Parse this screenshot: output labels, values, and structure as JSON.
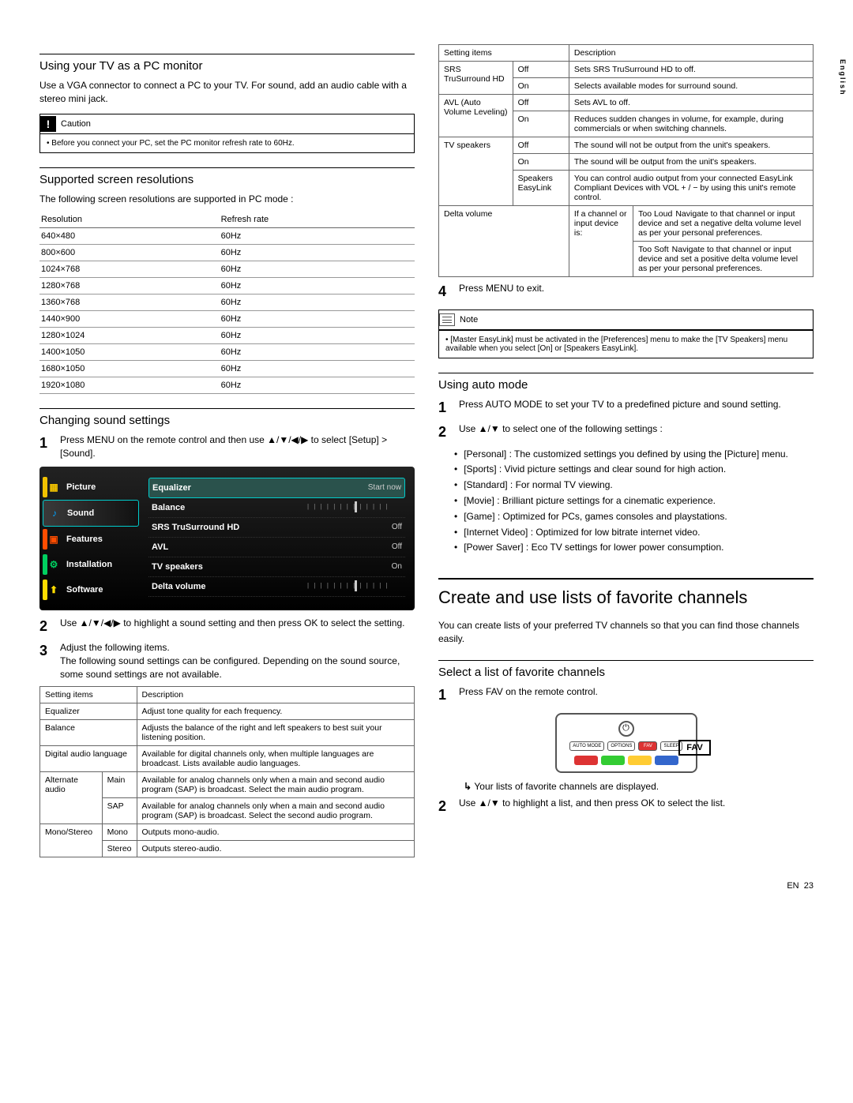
{
  "lang_tab": "English",
  "left": {
    "sec1": {
      "title": "Using your TV as a PC monitor",
      "p": "Use a VGA connector to connect a PC to your TV. For sound, add an audio cable with a stereo mini jack.",
      "caution_label": "Caution",
      "caution_body": "Before you connect your PC, set the PC monitor refresh rate to 60Hz."
    },
    "sec2": {
      "title": "Supported screen resolutions",
      "p": "The following screen resolutions are supported in PC mode :",
      "th1": "Resolution",
      "th2": "Refresh rate",
      "rows": [
        {
          "r": "640×480",
          "h": "60Hz"
        },
        {
          "r": "800×600",
          "h": "60Hz"
        },
        {
          "r": "1024×768",
          "h": "60Hz"
        },
        {
          "r": "1280×768",
          "h": "60Hz"
        },
        {
          "r": "1360×768",
          "h": "60Hz"
        },
        {
          "r": "1440×900",
          "h": "60Hz"
        },
        {
          "r": "1280×1024",
          "h": "60Hz"
        },
        {
          "r": "1400×1050",
          "h": "60Hz"
        },
        {
          "r": "1680×1050",
          "h": "60Hz"
        },
        {
          "r": "1920×1080",
          "h": "60Hz"
        }
      ]
    },
    "sec3": {
      "title": "Changing sound settings",
      "step1": "Press MENU on the remote control and then use ▲/▼/◀/▶ to select [Setup] > [Sound].",
      "osd": {
        "menu": [
          {
            "label": "Picture",
            "color": "#f2c200"
          },
          {
            "label": "Sound",
            "color": "#00a2ff",
            "active": true
          },
          {
            "label": "Features",
            "color": "#ff4d00"
          },
          {
            "label": "Installation",
            "color": "#00d060"
          },
          {
            "label": "Software",
            "color": "#ffdd00"
          }
        ],
        "rows": [
          {
            "k": "Equalizer",
            "v": "Start now",
            "hl": true
          },
          {
            "k": "Balance",
            "v": "slider"
          },
          {
            "k": "SRS TruSurround HD",
            "v": "Off"
          },
          {
            "k": "AVL",
            "v": "Off"
          },
          {
            "k": "TV speakers",
            "v": "On"
          },
          {
            "k": "Delta volume",
            "v": "slider"
          }
        ]
      },
      "step2": "Use ▲/▼/◀/▶ to highlight a sound setting and then press OK to select the setting.",
      "step3a": "Adjust the following items.",
      "step3b": "The following sound settings can be configured. Depending on the sound source, some sound settings are not available.",
      "tbl": {
        "h1": "Setting items",
        "h2": "Description",
        "rows": [
          {
            "a": "Equalizer",
            "d": "Adjust tone quality for each frequency."
          },
          {
            "a": "Balance",
            "d": "Adjusts the balance of the right and left speakers to best suit your listening position."
          },
          {
            "a": "Digital audio language",
            "d": "Available for digital channels only, when multiple languages are broadcast. Lists available audio languages."
          },
          {
            "a": "Alternate audio",
            "sub": "Main",
            "d": "Available for analog channels only when a main and second audio program (SAP) is broadcast. Select the main audio program."
          },
          {
            "a": "",
            "sub": "SAP",
            "d": "Available for analog channels only when a main and second audio program (SAP) is broadcast. Select the second audio program."
          },
          {
            "a": "Mono/Stereo",
            "sub": "Mono",
            "d": "Outputs mono-audio."
          },
          {
            "a": "",
            "sub": "Stereo",
            "d": "Outputs stereo-audio."
          }
        ]
      }
    }
  },
  "right": {
    "tbl2": {
      "h1": "Setting items",
      "h2": "Description",
      "srs": {
        "label": "SRS TruSurround HD",
        "off": "Off",
        "off_d": "Sets SRS TruSurround HD to off.",
        "on": "On",
        "on_d": "Selects available modes for surround sound."
      },
      "avl": {
        "label": "AVL (Auto Volume Leveling)",
        "off": "Off",
        "off_d": "Sets AVL to off.",
        "on": "On",
        "on_d": "Reduces sudden changes in volume, for example, during commercials or when switching channels."
      },
      "tvsp": {
        "label": "TV speakers",
        "off": "Off",
        "off_d": "The sound will not be output from the unit's speakers.",
        "on": "On",
        "on_d": "The sound will be output from the unit's speakers.",
        "el": "Speakers EasyLink",
        "el_d": "You can control audio output from your connected EasyLink Compliant Devices with VOL + / − by using this unit's remote control."
      },
      "delta": {
        "label": "Delta volume",
        "cond": "If a channel or input device is:",
        "loud": "Too Loud",
        "loud_d": "Navigate to that channel or input device and set a negative delta volume level as per your personal preferences.",
        "soft": "Too Soft",
        "soft_d": "Navigate to that channel or input device and set a positive delta volume level as per your personal preferences."
      }
    },
    "step4": "Press MENU to exit.",
    "note_label": "Note",
    "note_body": "[Master EasyLink] must be activated in the [Preferences] menu to make the [TV Speakers] menu available when you select [On] or [Speakers EasyLink].",
    "auto": {
      "title": "Using auto mode",
      "s1": "Press AUTO MODE to set your TV to a predefined picture and sound setting.",
      "s2": "Use ▲/▼ to select one of the following settings :",
      "items": [
        "[Personal] : The customized settings you defined by using the [Picture] menu.",
        "[Sports] : Vivid picture settings and clear sound for high action.",
        "[Standard] : For normal TV viewing.",
        "[Movie] : Brilliant picture settings for a cinematic experience.",
        "[Game] : Optimized for PCs, games consoles and playstations.",
        "[Internet Video] : Optimized for low bitrate internet video.",
        "[Power Saver] : Eco TV settings for lower power consumption."
      ]
    },
    "fav": {
      "title": "Create and use lists of favorite channels",
      "p": "You can create lists of your preferred TV channels so that you can find those channels easily.",
      "sub": "Select a list of favorite channels",
      "s1": "Press FAV on the remote control.",
      "fav_btn": "FAV",
      "remote_btns": [
        "AUTO MODE",
        "OPTIONS",
        "FAV",
        "SLEEP"
      ],
      "result": "Your lists of favorite channels are displayed.",
      "s2": "Use ▲/▼ to highlight a list, and then press OK to select the list."
    }
  },
  "footer": {
    "lang": "EN",
    "page": "23"
  }
}
